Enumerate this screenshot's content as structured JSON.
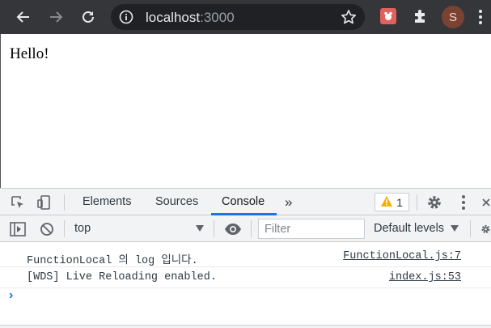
{
  "browser": {
    "url_host": "localhost",
    "url_port": ":3000",
    "profile_initial": "S",
    "icons": {
      "back": "back-arrow-icon",
      "forward": "forward-arrow-icon",
      "reload": "reload-icon",
      "info": "info-icon",
      "star": "star-icon",
      "extension": "puzzle-icon",
      "menu": "kebab-menu-icon"
    }
  },
  "page": {
    "text": "Hello!"
  },
  "devtools": {
    "tabs": [
      {
        "label": "Elements",
        "active": false
      },
      {
        "label": "Sources",
        "active": false
      },
      {
        "label": "Console",
        "active": true
      }
    ],
    "more_tabs": "»",
    "warnings_count": "1",
    "console_toolbar": {
      "context": "top",
      "filter_placeholder": "Filter",
      "levels": "Default levels"
    },
    "messages": [
      {
        "text": "FunctionLocal 의 log 입니다.",
        "source": "FunctionLocal.js:7"
      },
      {
        "text": "[WDS] Live Reloading enabled.",
        "source": "index.js:53"
      }
    ],
    "prompt": "›"
  },
  "colors": {
    "toolbar_bg": "#35363a",
    "omnibox_bg": "#202124",
    "devtools_bg": "#f1f3f4",
    "accent_blue": "#1a73e8",
    "warning_yellow": "#f9ab00"
  }
}
